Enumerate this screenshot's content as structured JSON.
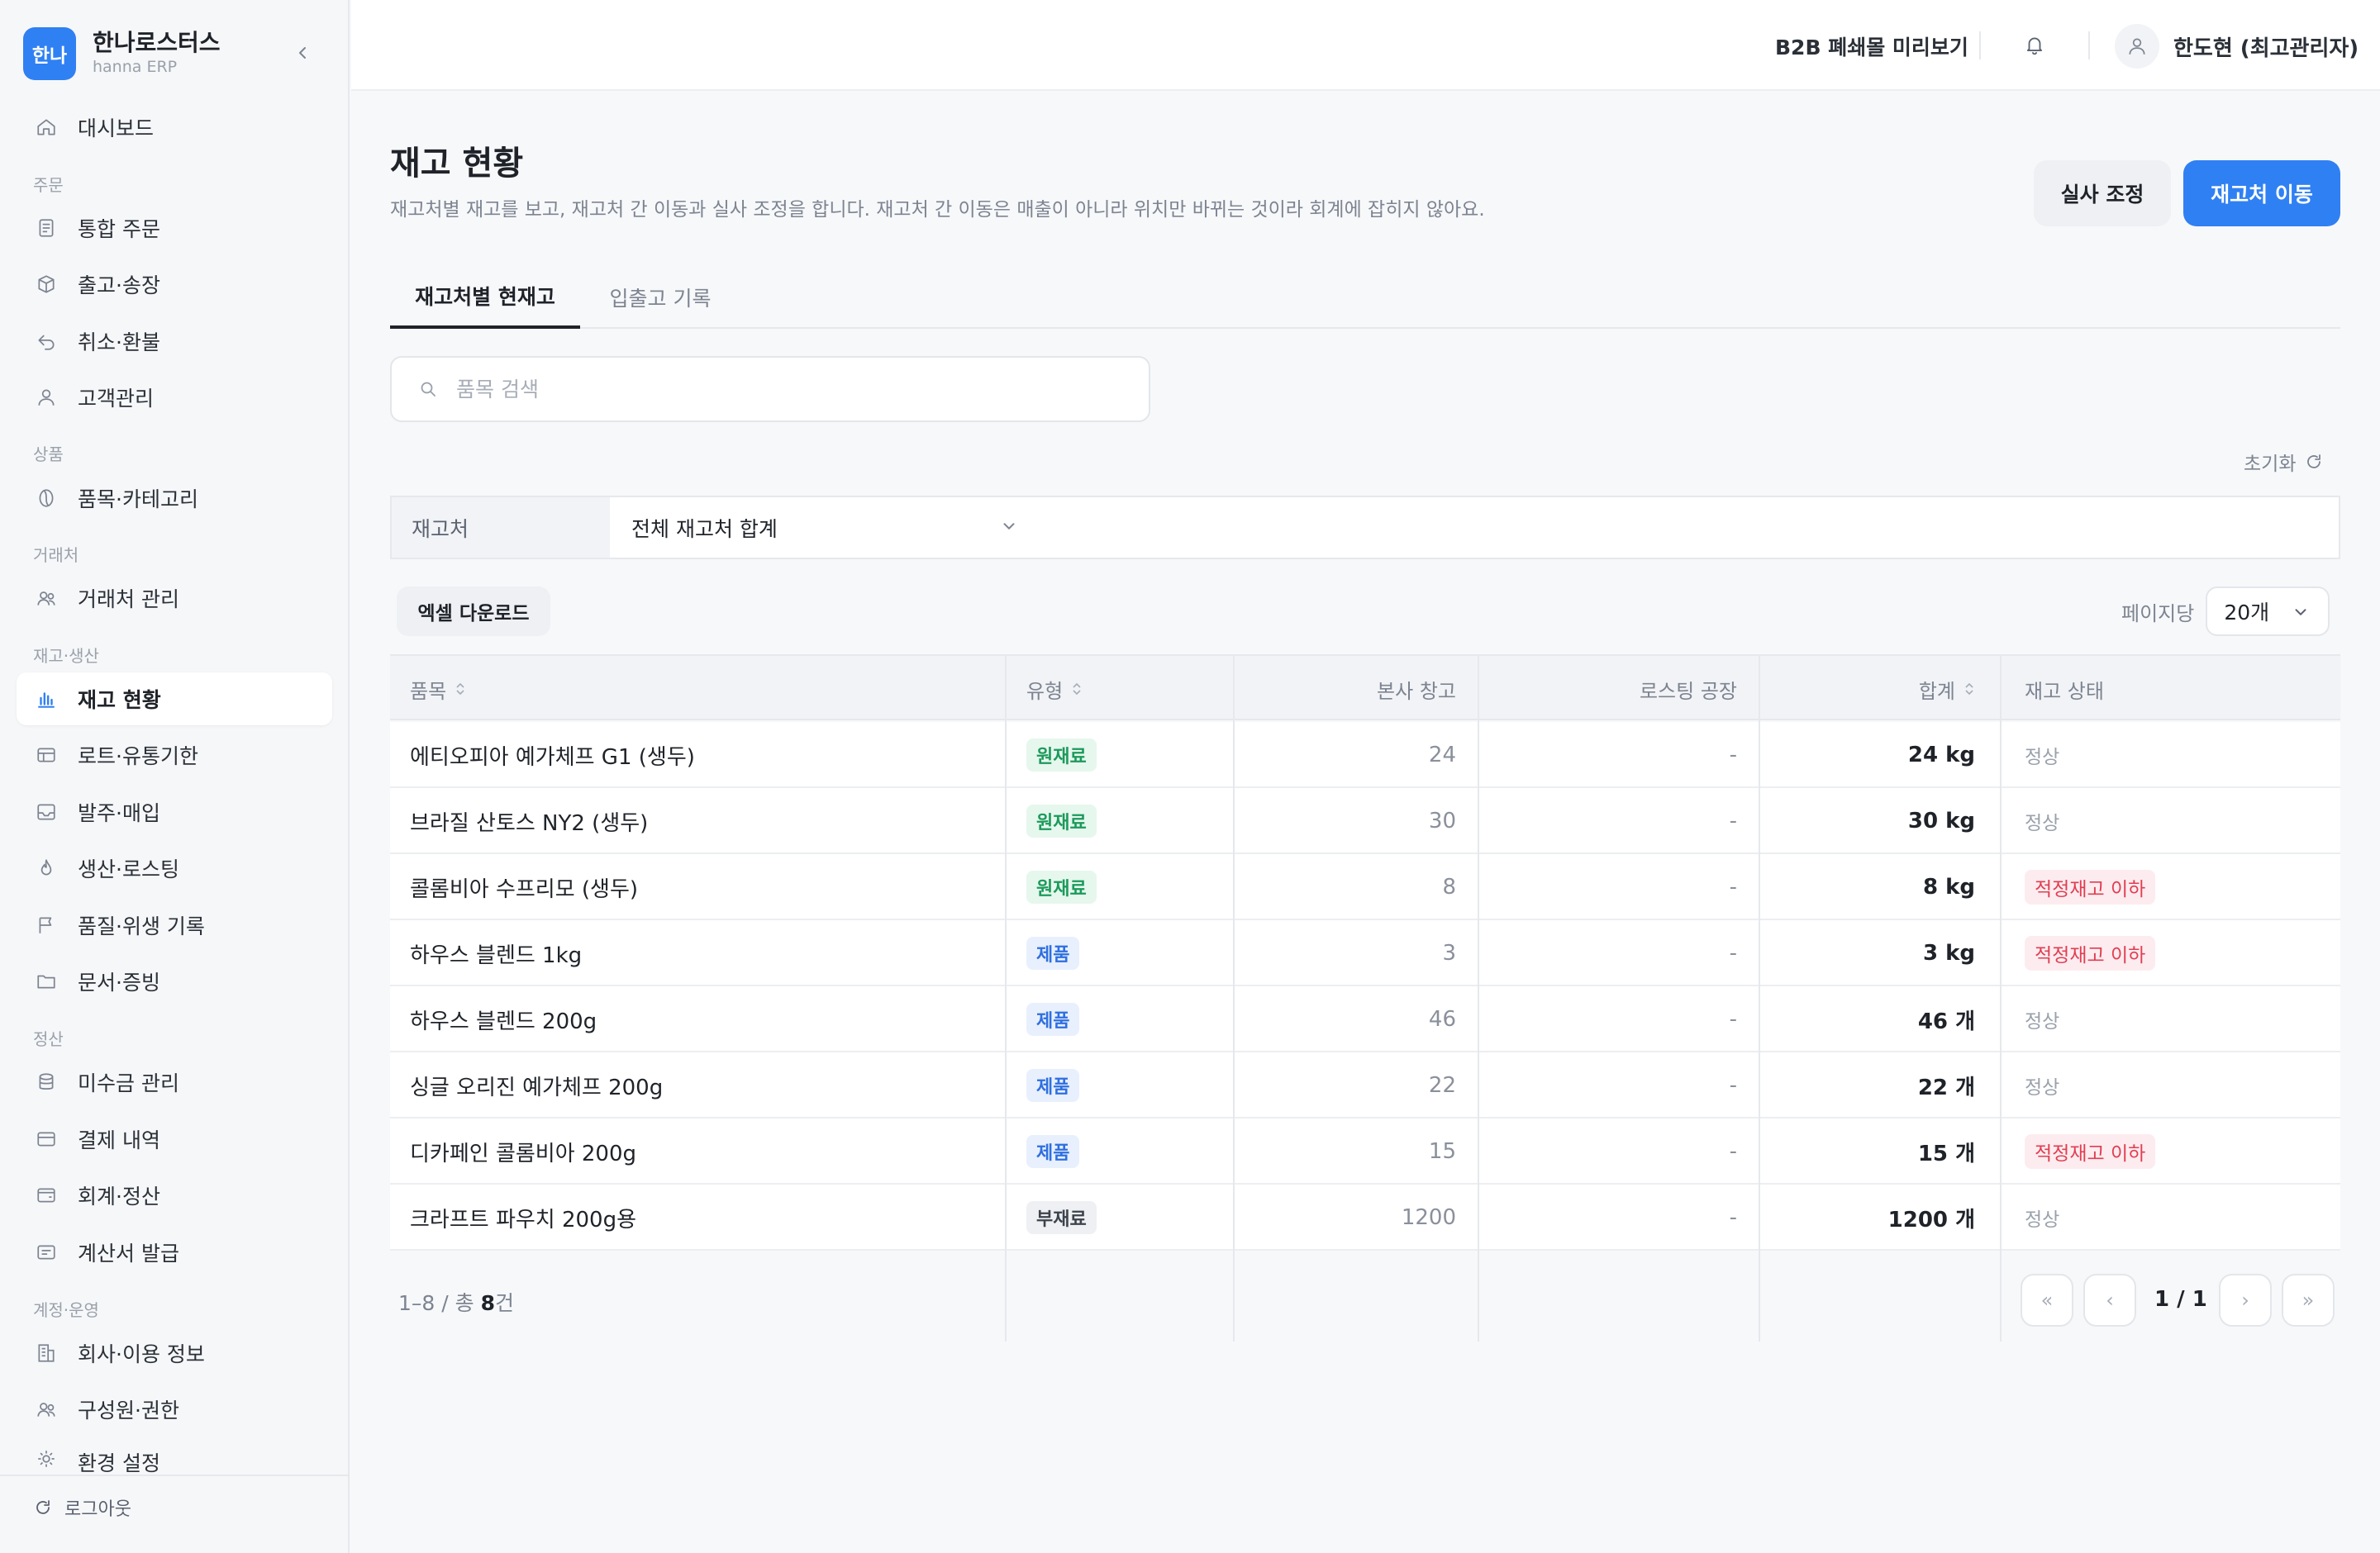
{
  "brand": {
    "logo": "한나",
    "name": "한나로스터스",
    "sub": "hanna ERP"
  },
  "colors": {
    "accent": "#2f80f3",
    "raw": "#1c9a5a",
    "product": "#2f6fdf",
    "warning": "#e03e52"
  },
  "sidebar": {
    "dashboard": "대시보드",
    "sections": {
      "order": "주문",
      "product": "상품",
      "partner": "거래처",
      "inventory": "재고·생산",
      "settle": "정산",
      "account": "계정·운영"
    },
    "items": {
      "orders": "통합 주문",
      "shipping": "출고·송장",
      "refund": "취소·환불",
      "customers": "고객관리",
      "catalog": "품목·카테고리",
      "partners": "거래처 관리",
      "stock": "재고 현황",
      "lots": "로트·유통기한",
      "purchase": "발주·매입",
      "roasting": "생산·로스팅",
      "quality": "품질·위생 기록",
      "documents": "문서·증빙",
      "receivables": "미수금 관리",
      "payments": "결제 내역",
      "accounting": "회계·정산",
      "invoices": "계산서 발급",
      "company": "회사·이용 정보",
      "members": "구성원·권한",
      "settings": "환경 설정"
    },
    "logout": "로그아웃"
  },
  "header": {
    "preview": "B2B 폐쇄몰 미리보기",
    "user": "한도현 (최고관리자)"
  },
  "page": {
    "title": "재고 현황",
    "description": "재고처별 재고를 보고, 재고처 간 이동과 실사 조정을 합니다. 재고처 간 이동은 매출이 아니라 위치만 바뀌는 것이라 회계에 잡히지 않아요.",
    "adjust_label": "실사 조정",
    "move_label": "재고처 이동",
    "tabs": [
      "재고처별 현재고",
      "입출고 기록"
    ],
    "search_placeholder": "품목 검색",
    "reset_label": "초기화",
    "filter_label": "재고처",
    "filter_value": "전체 재고처 합계",
    "excel_label": "엑셀 다운로드",
    "per_page_label": "페이지당",
    "per_page_value": "20개"
  },
  "table": {
    "headers": [
      "품목",
      "유형",
      "본사 창고",
      "로스팅 공장",
      "합계",
      "재고 상태"
    ],
    "rows": [
      {
        "name": "에티오피아 예가체프 G1 (생두)",
        "type": "원재료",
        "hq": "24",
        "roast": "-",
        "total": "24 kg",
        "status": "정상"
      },
      {
        "name": "브라질 산토스 NY2 (생두)",
        "type": "원재료",
        "hq": "30",
        "roast": "-",
        "total": "30 kg",
        "status": "정상"
      },
      {
        "name": "콜롬비아 수프리모 (생두)",
        "type": "원재료",
        "hq": "8",
        "roast": "-",
        "total": "8 kg",
        "status": "적정재고 이하"
      },
      {
        "name": "하우스 블렌드 1kg",
        "type": "제품",
        "hq": "3",
        "roast": "-",
        "total": "3 kg",
        "status": "적정재고 이하"
      },
      {
        "name": "하우스 블렌드 200g",
        "type": "제품",
        "hq": "46",
        "roast": "-",
        "total": "46 개",
        "status": "정상"
      },
      {
        "name": "싱글 오리진 예가체프 200g",
        "type": "제품",
        "hq": "22",
        "roast": "-",
        "total": "22 개",
        "status": "정상"
      },
      {
        "name": "디카페인 콜롬비아 200g",
        "type": "제품",
        "hq": "15",
        "roast": "-",
        "total": "15 개",
        "status": "적정재고 이하"
      },
      {
        "name": "크라프트 파우치 200g용",
        "type": "부재료",
        "hq": "1200",
        "roast": "-",
        "total": "1200 개",
        "status": "정상"
      }
    ]
  },
  "footer": {
    "count_prefix": "1–8 / 총 ",
    "count_total": "8",
    "count_suffix": "건",
    "page_label": "1 / 1",
    "first": "«",
    "prev": "‹",
    "next": "›",
    "last": "»"
  }
}
